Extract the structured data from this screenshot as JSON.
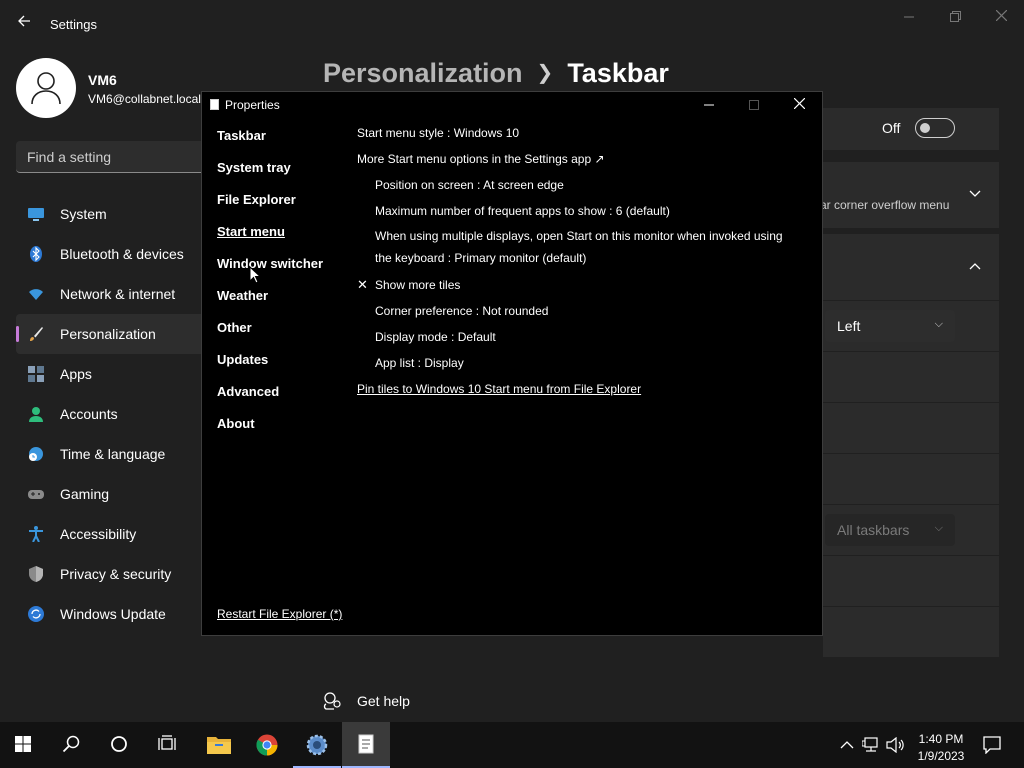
{
  "window": {
    "title": "Settings",
    "back_icon": "back-arrow-icon"
  },
  "profile": {
    "name": "VM6",
    "email": "VM6@collabnet.local"
  },
  "search": {
    "placeholder": "Find a setting"
  },
  "sidebar": {
    "items": [
      {
        "label": "System",
        "icon": "system-icon",
        "color": "#3a96dd"
      },
      {
        "label": "Bluetooth & devices",
        "icon": "bluetooth-icon",
        "color": "#2d7ad6"
      },
      {
        "label": "Network & internet",
        "icon": "wifi-icon",
        "color": "#3a96dd"
      },
      {
        "label": "Personalization",
        "icon": "brush-icon",
        "color": "#e3a44b",
        "active": true
      },
      {
        "label": "Apps",
        "icon": "apps-icon",
        "color": "#8aa0b8"
      },
      {
        "label": "Accounts",
        "icon": "accounts-icon",
        "color": "#2ebd7c"
      },
      {
        "label": "Time & language",
        "icon": "clock-globe-icon",
        "color": "#3a96dd"
      },
      {
        "label": "Gaming",
        "icon": "gamepad-icon",
        "color": "#8a8a8a"
      },
      {
        "label": "Accessibility",
        "icon": "accessibility-icon",
        "color": "#3a96dd"
      },
      {
        "label": "Privacy & security",
        "icon": "shield-icon",
        "color": "#8a8a8a"
      },
      {
        "label": "Windows Update",
        "icon": "update-icon",
        "color": "#2d7ad6"
      }
    ]
  },
  "header": {
    "parent": "Personalization",
    "current": "Taskbar"
  },
  "main": {
    "toggle_state": "Off",
    "overflow_text": "ar corner overflow menu",
    "alignment_value": "Left",
    "multi_display_value": "All taskbars"
  },
  "help": {
    "label": "Get help"
  },
  "dialog": {
    "title": "Properties",
    "nav": [
      {
        "label": "Taskbar"
      },
      {
        "label": "System tray"
      },
      {
        "label": "File Explorer"
      },
      {
        "label": "Start menu",
        "active": true
      },
      {
        "label": "Window switcher"
      },
      {
        "label": "Weather"
      },
      {
        "label": "Other"
      },
      {
        "label": "Updates"
      },
      {
        "label": "Advanced"
      },
      {
        "label": "About"
      }
    ],
    "restart_label": "Restart File Explorer (*)",
    "options": {
      "style": "Start menu style : Windows 10",
      "more_options": "More Start menu options in the Settings app ↗",
      "position": "Position on screen : At screen edge",
      "max_frequent": "Maximum number of frequent apps to show : 6 (default)",
      "multi_display_line1": "When using multiple displays, open Start on this monitor when invoked using",
      "multi_display_line2": "the keyboard : Primary monitor (default)",
      "show_more_tiles": "Show more tiles",
      "corner": "Corner preference : Not rounded",
      "display_mode": "Display mode : Default",
      "app_list": "App list : Display",
      "pin_tiles": "Pin tiles to Windows 10 Start menu from File Explorer"
    }
  },
  "taskbar": {
    "items": [
      "start-icon",
      "search-icon",
      "cortana-icon",
      "task-view-icon",
      "file-explorer-icon",
      "chrome-icon",
      "settings-icon",
      "properties-app-icon"
    ],
    "accent": "#9fb7ff",
    "time": "1:40 PM",
    "date": "1/9/2023"
  }
}
